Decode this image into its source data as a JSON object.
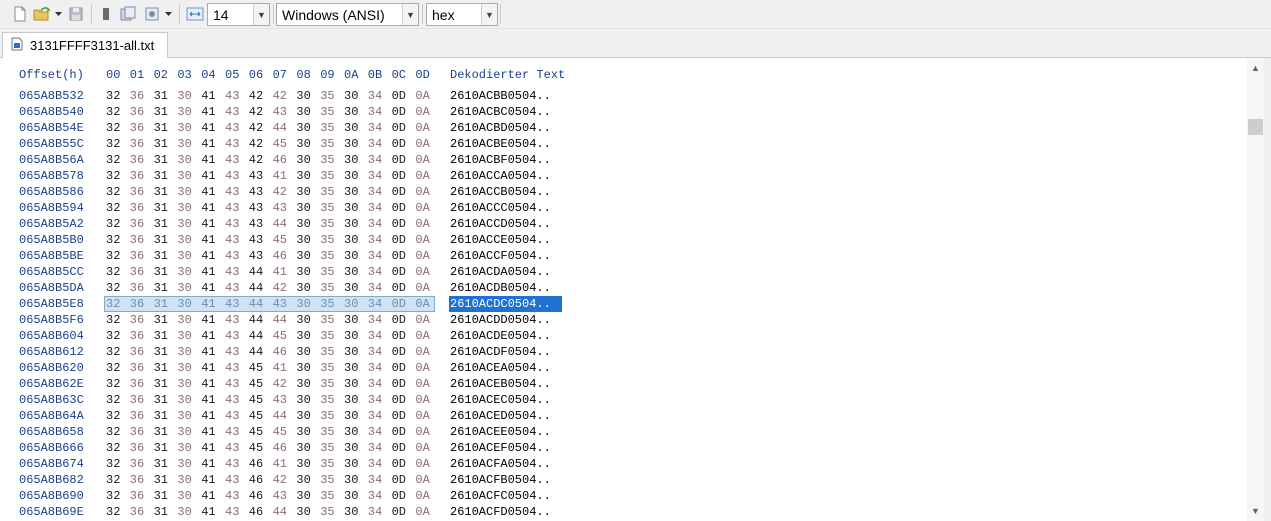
{
  "toolbar": {
    "icons": [
      "new-file-icon",
      "open-folder-icon",
      "dropdown-arrow-icon",
      "save-icon",
      "grip-icon",
      "copy-icon",
      "properties-icon",
      "page-icon",
      "dropdown-arrow-icon",
      "width-icon"
    ],
    "bytes_per_row": "14",
    "encoding": "Windows (ANSI)",
    "display_mode": "hex"
  },
  "tab": {
    "label": "3131FFFF3131-all.txt",
    "icon": "hex-file-icon"
  },
  "header": {
    "offset_label": "Offset(h)",
    "columns": [
      "00",
      "01",
      "02",
      "03",
      "04",
      "05",
      "06",
      "07",
      "08",
      "09",
      "0A",
      "0B",
      "0C",
      "0D"
    ],
    "decoded_label": "Dekodierter Text"
  },
  "rows": [
    {
      "offset": "065A8B532",
      "bytes": [
        "32",
        "36",
        "31",
        "30",
        "41",
        "43",
        "42",
        "42",
        "30",
        "35",
        "30",
        "34",
        "0D",
        "0A"
      ],
      "text": "2610ACBB0504.."
    },
    {
      "offset": "065A8B540",
      "bytes": [
        "32",
        "36",
        "31",
        "30",
        "41",
        "43",
        "42",
        "43",
        "30",
        "35",
        "30",
        "34",
        "0D",
        "0A"
      ],
      "text": "2610ACBC0504.."
    },
    {
      "offset": "065A8B54E",
      "bytes": [
        "32",
        "36",
        "31",
        "30",
        "41",
        "43",
        "42",
        "44",
        "30",
        "35",
        "30",
        "34",
        "0D",
        "0A"
      ],
      "text": "2610ACBD0504.."
    },
    {
      "offset": "065A8B55C",
      "bytes": [
        "32",
        "36",
        "31",
        "30",
        "41",
        "43",
        "42",
        "45",
        "30",
        "35",
        "30",
        "34",
        "0D",
        "0A"
      ],
      "text": "2610ACBE0504.."
    },
    {
      "offset": "065A8B56A",
      "bytes": [
        "32",
        "36",
        "31",
        "30",
        "41",
        "43",
        "42",
        "46",
        "30",
        "35",
        "30",
        "34",
        "0D",
        "0A"
      ],
      "text": "2610ACBF0504.."
    },
    {
      "offset": "065A8B578",
      "bytes": [
        "32",
        "36",
        "31",
        "30",
        "41",
        "43",
        "43",
        "41",
        "30",
        "35",
        "30",
        "34",
        "0D",
        "0A"
      ],
      "text": "2610ACCA0504.."
    },
    {
      "offset": "065A8B586",
      "bytes": [
        "32",
        "36",
        "31",
        "30",
        "41",
        "43",
        "43",
        "42",
        "30",
        "35",
        "30",
        "34",
        "0D",
        "0A"
      ],
      "text": "2610ACCB0504.."
    },
    {
      "offset": "065A8B594",
      "bytes": [
        "32",
        "36",
        "31",
        "30",
        "41",
        "43",
        "43",
        "43",
        "30",
        "35",
        "30",
        "34",
        "0D",
        "0A"
      ],
      "text": "2610ACCC0504.."
    },
    {
      "offset": "065A8B5A2",
      "bytes": [
        "32",
        "36",
        "31",
        "30",
        "41",
        "43",
        "43",
        "44",
        "30",
        "35",
        "30",
        "34",
        "0D",
        "0A"
      ],
      "text": "2610ACCD0504.."
    },
    {
      "offset": "065A8B5B0",
      "bytes": [
        "32",
        "36",
        "31",
        "30",
        "41",
        "43",
        "43",
        "45",
        "30",
        "35",
        "30",
        "34",
        "0D",
        "0A"
      ],
      "text": "2610ACCE0504.."
    },
    {
      "offset": "065A8B5BE",
      "bytes": [
        "32",
        "36",
        "31",
        "30",
        "41",
        "43",
        "43",
        "46",
        "30",
        "35",
        "30",
        "34",
        "0D",
        "0A"
      ],
      "text": "2610ACCF0504.."
    },
    {
      "offset": "065A8B5CC",
      "bytes": [
        "32",
        "36",
        "31",
        "30",
        "41",
        "43",
        "44",
        "41",
        "30",
        "35",
        "30",
        "34",
        "0D",
        "0A"
      ],
      "text": "2610ACDA0504.."
    },
    {
      "offset": "065A8B5DA",
      "bytes": [
        "32",
        "36",
        "31",
        "30",
        "41",
        "43",
        "44",
        "42",
        "30",
        "35",
        "30",
        "34",
        "0D",
        "0A"
      ],
      "text": "2610ACDB0504.."
    },
    {
      "offset": "065A8B5E8",
      "bytes": [
        "32",
        "36",
        "31",
        "30",
        "41",
        "43",
        "44",
        "43",
        "30",
        "35",
        "30",
        "34",
        "0D",
        "0A"
      ],
      "text": "2610ACDC0504..",
      "selected": true
    },
    {
      "offset": "065A8B5F6",
      "bytes": [
        "32",
        "36",
        "31",
        "30",
        "41",
        "43",
        "44",
        "44",
        "30",
        "35",
        "30",
        "34",
        "0D",
        "0A"
      ],
      "text": "2610ACDD0504.."
    },
    {
      "offset": "065A8B604",
      "bytes": [
        "32",
        "36",
        "31",
        "30",
        "41",
        "43",
        "44",
        "45",
        "30",
        "35",
        "30",
        "34",
        "0D",
        "0A"
      ],
      "text": "2610ACDE0504.."
    },
    {
      "offset": "065A8B612",
      "bytes": [
        "32",
        "36",
        "31",
        "30",
        "41",
        "43",
        "44",
        "46",
        "30",
        "35",
        "30",
        "34",
        "0D",
        "0A"
      ],
      "text": "2610ACDF0504.."
    },
    {
      "offset": "065A8B620",
      "bytes": [
        "32",
        "36",
        "31",
        "30",
        "41",
        "43",
        "45",
        "41",
        "30",
        "35",
        "30",
        "34",
        "0D",
        "0A"
      ],
      "text": "2610ACEA0504.."
    },
    {
      "offset": "065A8B62E",
      "bytes": [
        "32",
        "36",
        "31",
        "30",
        "41",
        "43",
        "45",
        "42",
        "30",
        "35",
        "30",
        "34",
        "0D",
        "0A"
      ],
      "text": "2610ACEB0504.."
    },
    {
      "offset": "065A8B63C",
      "bytes": [
        "32",
        "36",
        "31",
        "30",
        "41",
        "43",
        "45",
        "43",
        "30",
        "35",
        "30",
        "34",
        "0D",
        "0A"
      ],
      "text": "2610ACEC0504.."
    },
    {
      "offset": "065A8B64A",
      "bytes": [
        "32",
        "36",
        "31",
        "30",
        "41",
        "43",
        "45",
        "44",
        "30",
        "35",
        "30",
        "34",
        "0D",
        "0A"
      ],
      "text": "2610ACED0504.."
    },
    {
      "offset": "065A8B658",
      "bytes": [
        "32",
        "36",
        "31",
        "30",
        "41",
        "43",
        "45",
        "45",
        "30",
        "35",
        "30",
        "34",
        "0D",
        "0A"
      ],
      "text": "2610ACEE0504.."
    },
    {
      "offset": "065A8B666",
      "bytes": [
        "32",
        "36",
        "31",
        "30",
        "41",
        "43",
        "45",
        "46",
        "30",
        "35",
        "30",
        "34",
        "0D",
        "0A"
      ],
      "text": "2610ACEF0504.."
    },
    {
      "offset": "065A8B674",
      "bytes": [
        "32",
        "36",
        "31",
        "30",
        "41",
        "43",
        "46",
        "41",
        "30",
        "35",
        "30",
        "34",
        "0D",
        "0A"
      ],
      "text": "2610ACFA0504.."
    },
    {
      "offset": "065A8B682",
      "bytes": [
        "32",
        "36",
        "31",
        "30",
        "41",
        "43",
        "46",
        "42",
        "30",
        "35",
        "30",
        "34",
        "0D",
        "0A"
      ],
      "text": "2610ACFB0504.."
    },
    {
      "offset": "065A8B690",
      "bytes": [
        "32",
        "36",
        "31",
        "30",
        "41",
        "43",
        "46",
        "43",
        "30",
        "35",
        "30",
        "34",
        "0D",
        "0A"
      ],
      "text": "2610ACFC0504.."
    },
    {
      "offset": "065A8B69E",
      "bytes": [
        "32",
        "36",
        "31",
        "30",
        "41",
        "43",
        "46",
        "44",
        "30",
        "35",
        "30",
        "34",
        "0D",
        "0A"
      ],
      "text": "2610ACFD0504.."
    }
  ],
  "colors": {
    "offset": "#1a3f8f",
    "byte_even": "#1c1c1c",
    "byte_odd": "#8a6f6a",
    "selection_hex_bg": "#cfe3f3",
    "selection_text_bg": "#1f72d2",
    "selection_text_fg": "#ffffff"
  },
  "scrollbar": {
    "up_icon": "scroll-up-arrow-icon",
    "down_icon": "scroll-down-arrow-icon"
  }
}
